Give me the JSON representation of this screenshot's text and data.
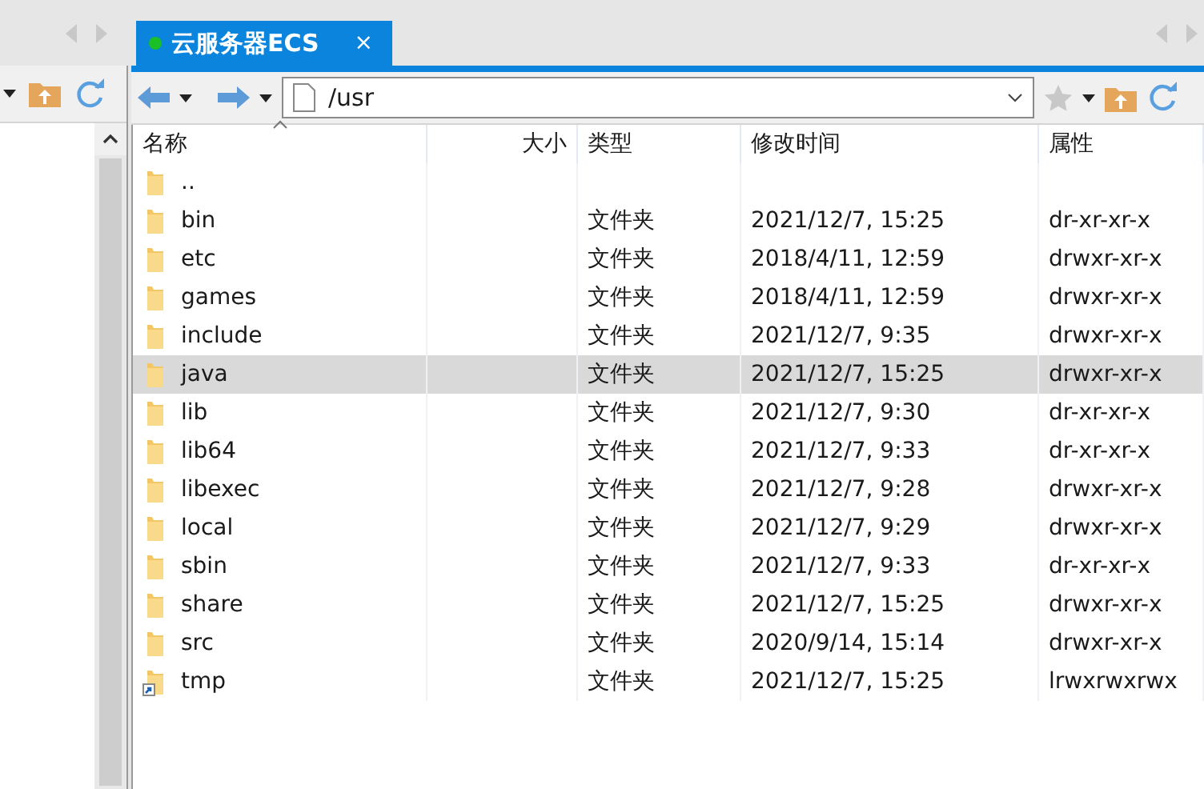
{
  "tab": {
    "title": "云服务器ECS",
    "connected": true,
    "close": "×"
  },
  "address": {
    "value": "/usr"
  },
  "columns": [
    {
      "label": "名称",
      "sorted": true
    },
    {
      "label": "大小",
      "sorted": false
    },
    {
      "label": "类型",
      "sorted": false
    },
    {
      "label": "修改时间",
      "sorted": false
    },
    {
      "label": "属性",
      "sorted": false
    }
  ],
  "rows": [
    {
      "kind": "folder",
      "name": "..",
      "selected": false
    },
    {
      "kind": "folder",
      "name": "bin",
      "type": "文件夹",
      "modified": "2021/12/7, 15:25",
      "attributes": "dr-xr-xr-x",
      "selected": false
    },
    {
      "kind": "folder",
      "name": "etc",
      "type": "文件夹",
      "modified": "2018/4/11, 12:59",
      "attributes": "drwxr-xr-x",
      "selected": false
    },
    {
      "kind": "folder",
      "name": "games",
      "type": "文件夹",
      "modified": "2018/4/11, 12:59",
      "attributes": "drwxr-xr-x",
      "selected": false
    },
    {
      "kind": "folder",
      "name": "include",
      "type": "文件夹",
      "modified": "2021/12/7, 9:35",
      "attributes": "drwxr-xr-x",
      "selected": false
    },
    {
      "kind": "folder",
      "name": "java",
      "type": "文件夹",
      "modified": "2021/12/7, 15:25",
      "attributes": "drwxr-xr-x",
      "selected": true
    },
    {
      "kind": "folder",
      "name": "lib",
      "type": "文件夹",
      "modified": "2021/12/7, 9:30",
      "attributes": "dr-xr-xr-x",
      "selected": false
    },
    {
      "kind": "folder",
      "name": "lib64",
      "type": "文件夹",
      "modified": "2021/12/7, 9:33",
      "attributes": "dr-xr-xr-x",
      "selected": false
    },
    {
      "kind": "folder",
      "name": "libexec",
      "type": "文件夹",
      "modified": "2021/12/7, 9:28",
      "attributes": "drwxr-xr-x",
      "selected": false
    },
    {
      "kind": "folder",
      "name": "local",
      "type": "文件夹",
      "modified": "2021/12/7, 9:29",
      "attributes": "drwxr-xr-x",
      "selected": false
    },
    {
      "kind": "folder",
      "name": "sbin",
      "type": "文件夹",
      "modified": "2021/12/7, 9:33",
      "attributes": "dr-xr-xr-x",
      "selected": false
    },
    {
      "kind": "folder",
      "name": "share",
      "type": "文件夹",
      "modified": "2021/12/7, 15:25",
      "attributes": "drwxr-xr-x",
      "selected": false
    },
    {
      "kind": "folder",
      "name": "src",
      "type": "文件夹",
      "modified": "2020/9/14, 15:14",
      "attributes": "drwxr-xr-x",
      "selected": false
    },
    {
      "kind": "link",
      "name": "tmp",
      "type": "文件夹",
      "modified": "2021/12/7, 15:25",
      "attributes": "lrwxrwxrwx",
      "selected": false
    }
  ]
}
